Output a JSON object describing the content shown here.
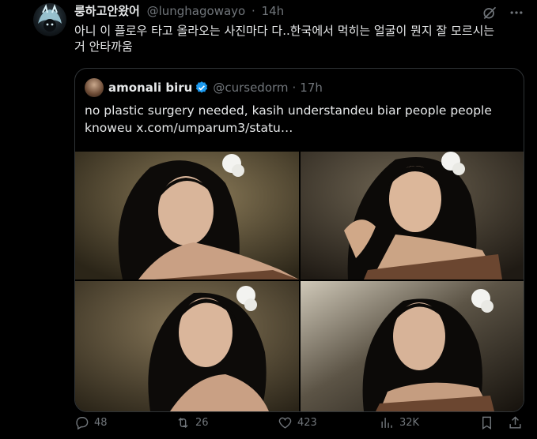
{
  "tweet": {
    "author_name": "룽하고안왔어",
    "author_handle": "@lunghagowayo",
    "separator": "·",
    "time": "14h",
    "text": "아니 이 플로우 타고 올라오는 사진마다 다..한국에서 먹히는 얼굴이 뭔지 잘 모르시는\n거 안타까움"
  },
  "quote": {
    "author_name": "amonali biru",
    "author_handle": "@cursedorm",
    "separator": "·",
    "time": "17h",
    "text_main": "no plastic surgery needed, kasih understandeu biar people people knoweu",
    "text_link": "x.com/umparum3/statu…"
  },
  "actions": {
    "replies": "48",
    "reposts": "26",
    "likes": "423",
    "views": "32K"
  },
  "icons": {
    "reply": "reply-icon",
    "repost": "repost-icon",
    "like": "heart-icon",
    "views": "views-icon",
    "bookmark": "bookmark-icon",
    "share": "share-icon",
    "grok": "grok-icon",
    "more": "more-icon",
    "verified": "verified-badge-icon"
  },
  "colors": {
    "background": "#000000",
    "text": "#e7e9ea",
    "muted": "#71767b",
    "verified": "#1d9bf0",
    "border": "#2f3336"
  }
}
